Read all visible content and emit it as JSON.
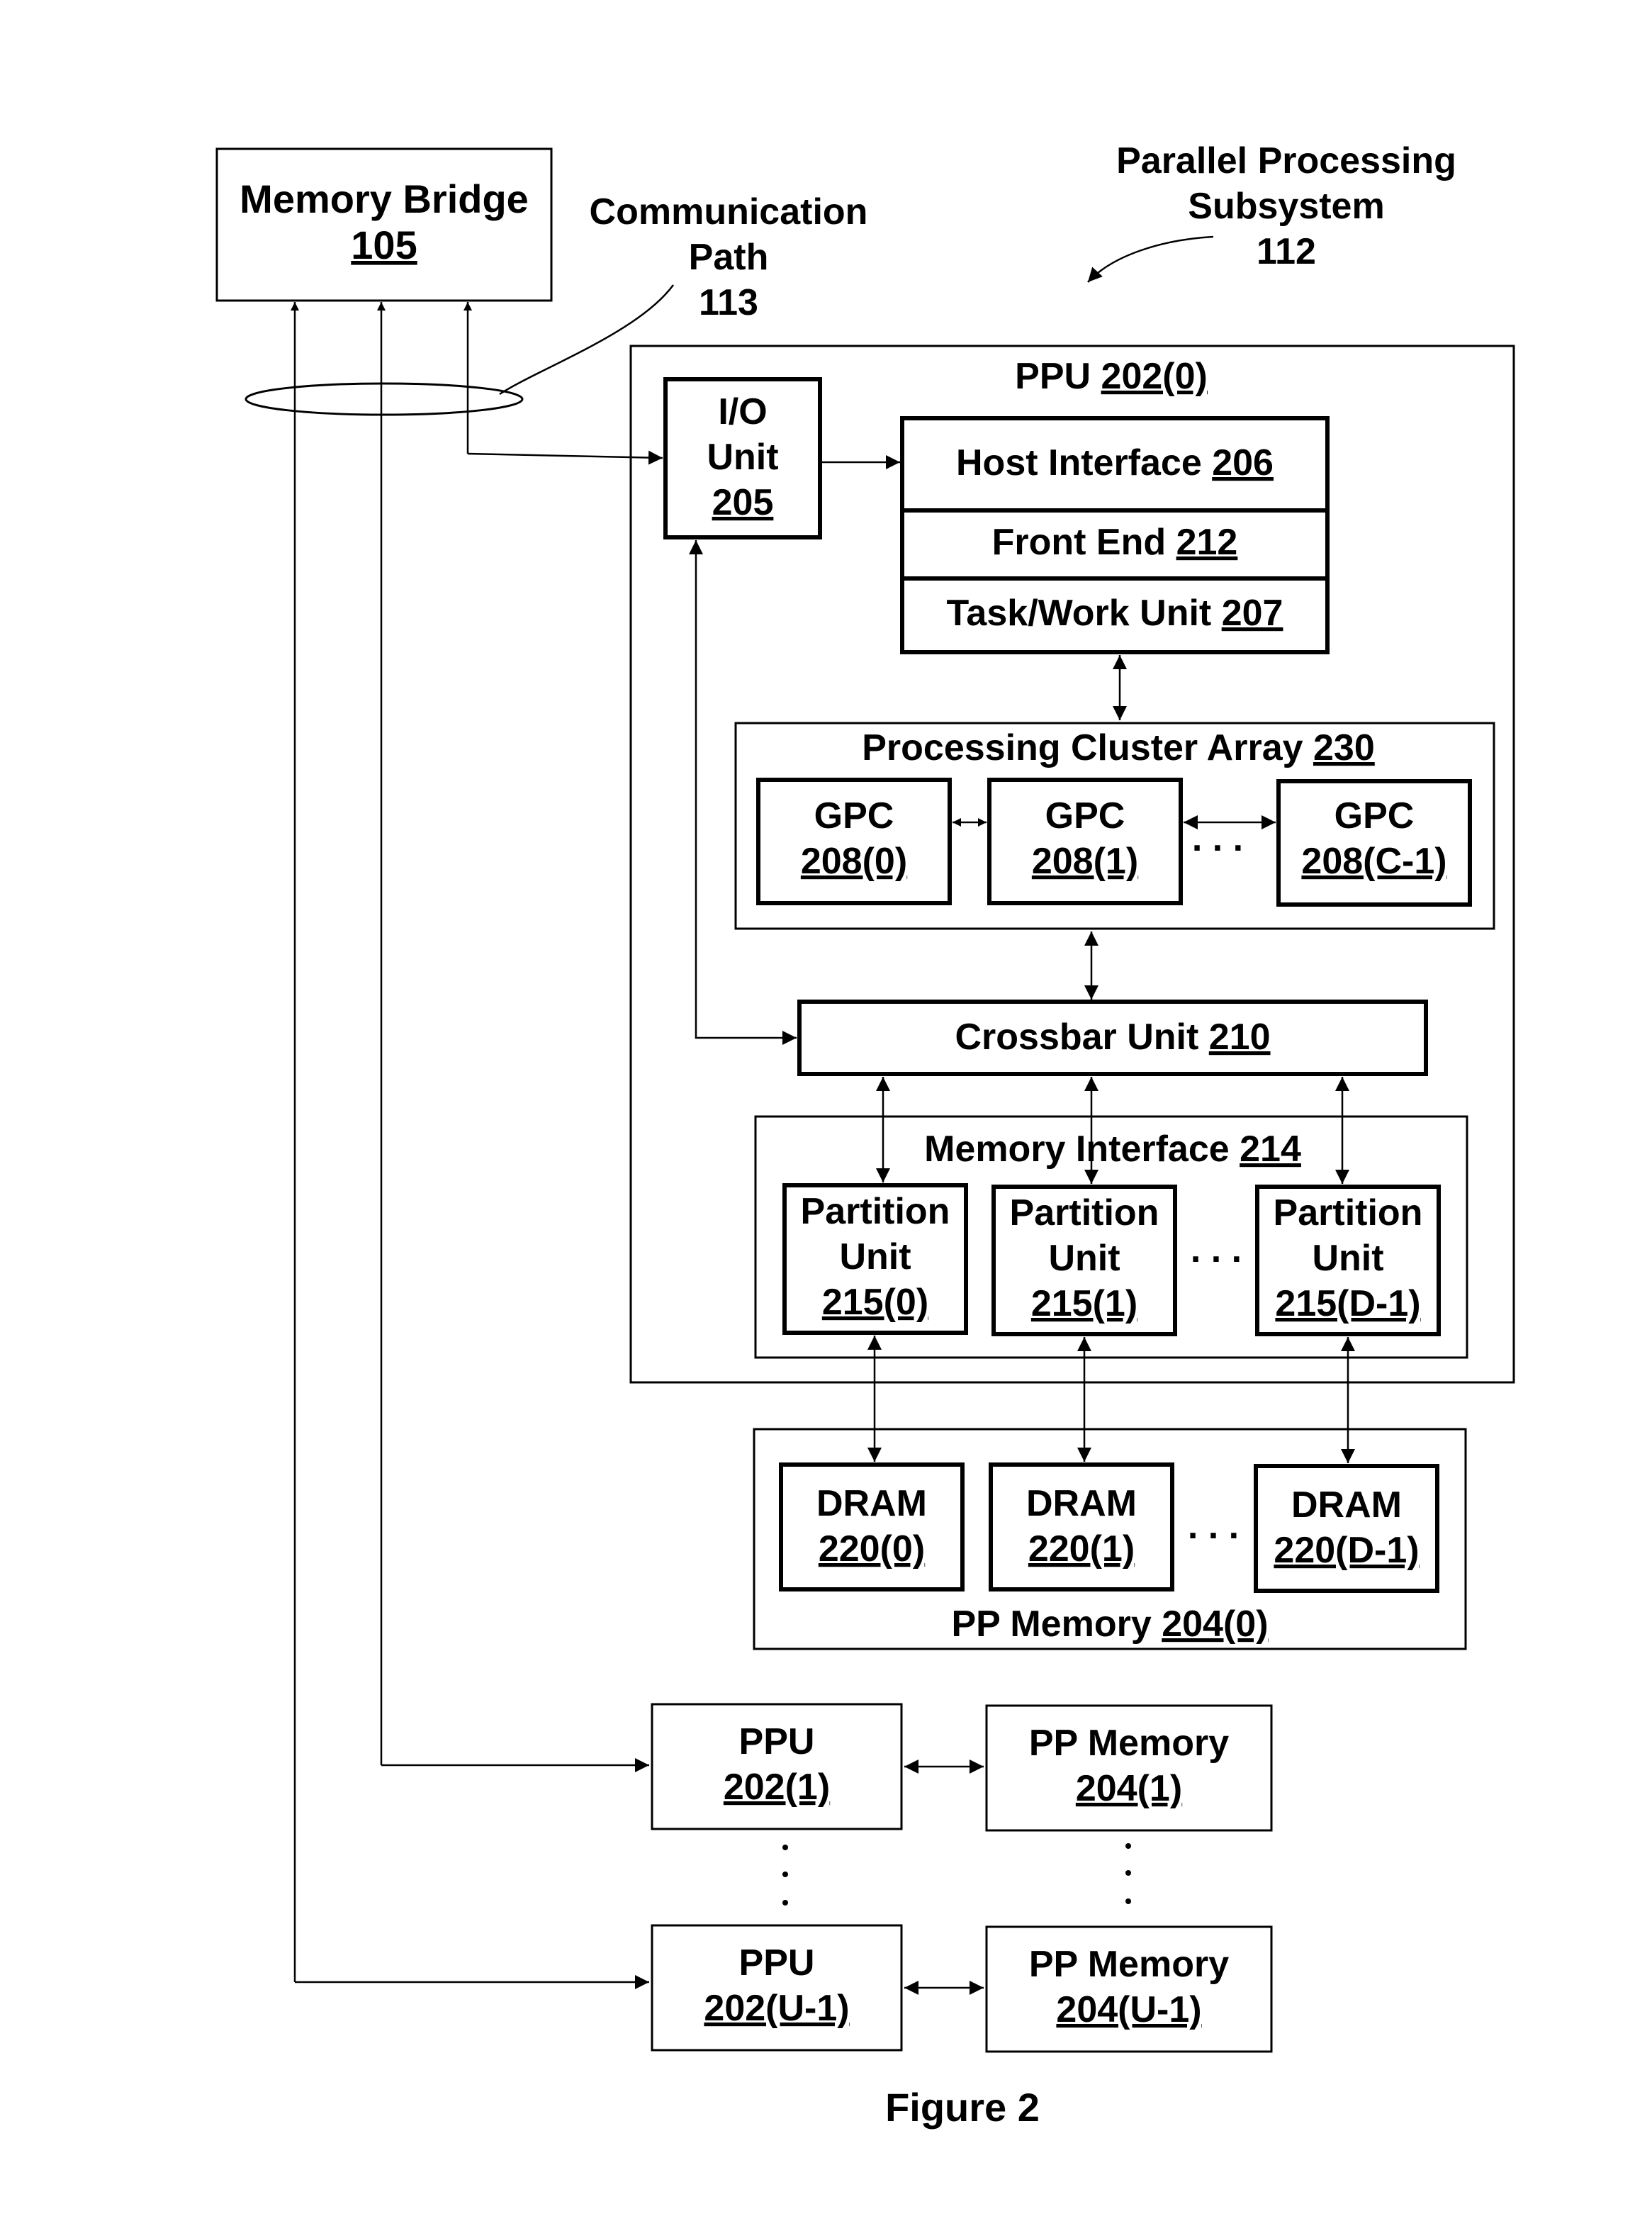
{
  "figure": {
    "caption": "Figure 2",
    "subsystem": {
      "line1": "Parallel Processing",
      "line2": "Subsystem",
      "ref": "112"
    },
    "comm_path": {
      "line1": "Communication",
      "line2": "Path",
      "ref": "113"
    },
    "memory_bridge": {
      "name": "Memory Bridge",
      "ref": "105"
    },
    "ppu0": {
      "name": "PPU",
      "ref": "202(0)"
    },
    "io_unit": {
      "line1": "I/O",
      "line2": "Unit",
      "ref": "205"
    },
    "host_interface": {
      "name": "Host Interface",
      "ref": "206"
    },
    "front_end": {
      "name": "Front End",
      "ref": "212"
    },
    "task_work_unit": {
      "name": "Task/Work Unit",
      "ref": "207"
    },
    "pca": {
      "name": "Processing Cluster Array",
      "ref": "230"
    },
    "gpcs": [
      {
        "name": "GPC",
        "ref": "208(0)"
      },
      {
        "name": "GPC",
        "ref": "208(1)"
      },
      {
        "name": "GPC",
        "ref": "208(C-1)"
      }
    ],
    "crossbar": {
      "name": "Crossbar Unit",
      "ref": "210"
    },
    "memory_interface": {
      "name": "Memory Interface",
      "ref": "214"
    },
    "partitions": [
      {
        "line1": "Partition",
        "line2": "Unit",
        "ref": "215(0)"
      },
      {
        "line1": "Partition",
        "line2": "Unit",
        "ref": "215(1)"
      },
      {
        "line1": "Partition",
        "line2": "Unit",
        "ref": "215(D-1)"
      }
    ],
    "drams": [
      {
        "name": "DRAM",
        "ref": "220(0)"
      },
      {
        "name": "DRAM",
        "ref": "220(1)"
      },
      {
        "name": "DRAM",
        "ref": "220(D-1)"
      }
    ],
    "pp_memory0": {
      "name": "PP Memory",
      "ref": "204(0)"
    },
    "ppu1": {
      "name": "PPU",
      "ref": "202(1)"
    },
    "pp_memory1": {
      "name": "PP Memory",
      "ref": "204(1)"
    },
    "ppu_last": {
      "name": "PPU",
      "ref": "202(U-1)"
    },
    "pp_memory_last": {
      "name": "PP Memory",
      "ref": "204(U-1)"
    },
    "ellipsis": ". . ."
  }
}
